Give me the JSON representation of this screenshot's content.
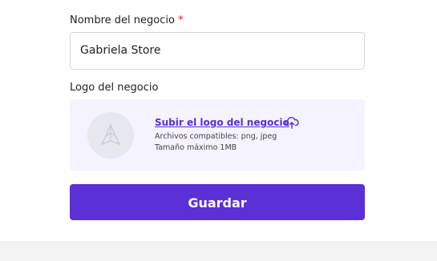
{
  "form": {
    "business_name_label": "Nombre del negocio",
    "required_mark": "*",
    "business_name_value": "Gabriela Store",
    "logo_label": "Logo del negocio",
    "upload": {
      "link_text": "Subir el logo del negocio",
      "formats_hint": "Archivos compatibles: png, jpeg",
      "size_hint": "Tamaño máximo 1MB",
      "upload_icon": "cloud-upload-icon",
      "placeholder_icon": "store-logo-placeholder-icon"
    },
    "save_label": "Guardar"
  },
  "colors": {
    "accent": "#5b30d6",
    "upload_bg": "#f5f3ff",
    "required": "#e0242a"
  }
}
